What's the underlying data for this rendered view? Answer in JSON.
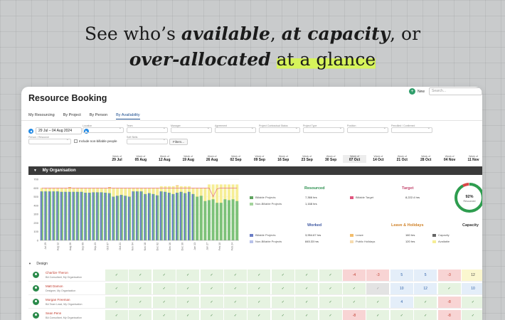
{
  "headline": {
    "line1_pre": "See who’s ",
    "line1_em1": "available",
    "line1_mid": ", ",
    "line1_em2": "at capacity",
    "line1_post": ", or",
    "line2_em": "over-allocated",
    "line2_highlight": "at a glance"
  },
  "app": {
    "title": "Resource Booking",
    "new_label": "New",
    "search_placeholder": "Search...",
    "tabs": [
      "My Resourcing",
      "By Project",
      "By Person",
      "By Availability"
    ],
    "active_tab": 3
  },
  "filters": {
    "date_range": "29 Jul – 04 Aug 2024",
    "labels": [
      "Location",
      "Team",
      "Manager",
      "Agreement",
      "Project Contractual Status",
      "Project Type",
      "Position",
      "Pencilled / Confirmed",
      "Person / Resource",
      "Soft Skills"
    ],
    "include_non_billable": "Include non-billable people",
    "filters_button": "Filters..."
  },
  "weeks": {
    "prefix": "Week of",
    "dates": [
      "29 Jul",
      "05 Aug",
      "12 Aug",
      "19 Aug",
      "26 Aug",
      "02 Sep",
      "09 Sep",
      "16 Sep",
      "23 Sep",
      "30 Sep",
      "07 Oct",
      "14 Oct",
      "21 Oct",
      "28 Oct",
      "04 Nov",
      "11 Nov"
    ],
    "current_index": 10
  },
  "org_label": "My Organisation",
  "chart_data": {
    "type": "bar",
    "categories": [
      "Jul 29",
      "Aug 12",
      "Aug 26",
      "Sep 09",
      "Sep 23",
      "Oct 07",
      "Oct 21",
      "Nov 04",
      "Nov 18",
      "Dec 02",
      "Dec 16",
      "Dec 30",
      "Jan 13",
      "Jan 27",
      "Feb 10",
      "Feb 24"
    ],
    "tick_labels": [
      "Jul 29",
      "Aug 12",
      "Aug 26",
      "Sep 09",
      "Sep 23",
      "Oct 07",
      "Oct 21",
      "Nov 04",
      "Nov 18",
      "Dec 02",
      "Dec 16",
      "Dec 30",
      "Jan 13",
      "Jan 27",
      "Feb 10",
      "Feb 24"
    ],
    "ylim": [
      0,
      700
    ],
    "yticks": [
      0,
      100,
      200,
      300,
      400,
      500,
      600,
      700
    ],
    "bars": {
      "billable": [
        560,
        560,
        560,
        560,
        560,
        555,
        555,
        555,
        555,
        555,
        555,
        545,
        545,
        550,
        550,
        550,
        545,
        540,
        500,
        510,
        520,
        510,
        500,
        560,
        560,
        560,
        530,
        540,
        530,
        515,
        560,
        555,
        545,
        530,
        545,
        555,
        540,
        555,
        530,
        500,
        510,
        450,
        460,
        470,
        430,
        430,
        470,
        460,
        470,
        450
      ],
      "worked": [
        560,
        560,
        560,
        560,
        560,
        555,
        555,
        555,
        555,
        555,
        555,
        545,
        545,
        550,
        550,
        550,
        545,
        540,
        500,
        510,
        520,
        510,
        500,
        560,
        560,
        560,
        530,
        540,
        530,
        515,
        560,
        555,
        545,
        530,
        545,
        555,
        540,
        555,
        530,
        0,
        0,
        0,
        0,
        0,
        0,
        0,
        0,
        0,
        0,
        0
      ],
      "capacity": [
        600,
        600,
        600,
        600,
        600,
        600,
        600,
        600,
        600,
        600,
        600,
        600,
        600,
        600,
        600,
        600,
        600,
        600,
        600,
        600,
        600,
        600,
        600,
        600,
        600,
        600,
        600,
        600,
        600,
        600,
        620,
        620,
        620,
        620,
        620,
        620,
        620,
        620,
        600,
        600,
        600,
        600,
        640,
        640,
        640,
        640,
        640,
        640,
        640,
        640
      ],
      "leave": [
        0,
        0,
        0,
        0,
        0,
        0,
        0,
        10,
        0,
        0,
        0,
        0,
        0,
        0,
        0,
        0,
        0,
        10,
        0,
        0,
        0,
        0,
        0,
        0,
        0,
        0,
        0,
        0,
        0,
        0,
        0,
        0,
        0,
        0,
        10,
        0,
        0,
        0,
        0,
        0,
        0,
        0,
        0,
        0,
        0,
        0,
        0,
        0,
        0,
        0
      ],
      "target_line": [
        600,
        600,
        600,
        600,
        600,
        600,
        600,
        600,
        600,
        600,
        600,
        600,
        600,
        600,
        600,
        600,
        600,
        600,
        600,
        600,
        600,
        600,
        600,
        600,
        600,
        600,
        600,
        600,
        600,
        600,
        600,
        600,
        600,
        600,
        600,
        600,
        600,
        600,
        600,
        600,
        600,
        600,
        600,
        500,
        590,
        600,
        600,
        600,
        600,
        600
      ]
    }
  },
  "summary": {
    "resourced": {
      "title": "Resourced",
      "rows": [
        {
          "label": "Billable Projects",
          "value": "7,366 hrs",
          "color": "#5fa35f"
        },
        {
          "label": "Non-Billable Projects",
          "value": "1,168 hrs",
          "color": "#a3d39c"
        }
      ]
    },
    "target": {
      "title": "Target",
      "rows": [
        {
          "label": "Billable Target",
          "value": "8,222.4 hrs",
          "color": "#e0567f"
        }
      ]
    },
    "worked": {
      "title": "Worked",
      "rows": [
        {
          "label": "Billable Projects",
          "value": "3,954.67 hrs",
          "color": "#6a7dc6"
        },
        {
          "label": "Non-Billable Projects",
          "value": "845.33 hrs",
          "color": "#b8c2ea"
        }
      ]
    },
    "leave": {
      "title": "Leave & Holidays",
      "rows": [
        {
          "label": "Leave",
          "value": "160 hrs",
          "color": "#f3bd6c"
        },
        {
          "label": "Public Holidays",
          "value": "120 hrs",
          "color": "#f6dcb0"
        }
      ]
    },
    "capacity": {
      "title": "Capacity",
      "rows": [
        {
          "label": "Capacity",
          "color": "#666666"
        },
        {
          "label": "Available",
          "color": "#f6ee96"
        }
      ]
    },
    "gauge": {
      "percent": 92,
      "percent_label": "92%",
      "caption": "Resourced",
      "color": "#2e9d4f",
      "over_color": "#d94848"
    }
  },
  "design_group": "Design",
  "people": [
    {
      "name": "Charlize Theron",
      "role": "BA Consultant, My Organisation",
      "cells": [
        [
          "ok",
          "✓"
        ],
        [
          "ok",
          "✓"
        ],
        [
          "ok",
          "✓"
        ],
        [
          "ok",
          "✓"
        ],
        [
          "ok",
          "✓"
        ],
        [
          "ok",
          "✓"
        ],
        [
          "ok",
          "✓"
        ],
        [
          "ok",
          "✓"
        ],
        [
          "ok",
          "✓"
        ],
        [
          "ok",
          "✓"
        ],
        [
          "over",
          "-4"
        ],
        [
          "over",
          "-3"
        ],
        [
          "avail",
          "5"
        ],
        [
          "avail",
          "5"
        ],
        [
          "over",
          "-3"
        ],
        [
          "cap",
          "12"
        ],
        [
          "cap",
          "12"
        ]
      ]
    },
    {
      "name": "Matt Damon",
      "role": "Designer, My Organisation",
      "cells": [
        [
          "ok",
          "✓"
        ],
        [
          "ok",
          "✓"
        ],
        [
          "ok",
          "✓"
        ],
        [
          "ok",
          "✓"
        ],
        [
          "ok",
          "✓"
        ],
        [
          "ok",
          "✓"
        ],
        [
          "ok",
          "✓"
        ],
        [
          "ok",
          "✓"
        ],
        [
          "ok",
          "✓"
        ],
        [
          "ok",
          "✓"
        ],
        [
          "ok",
          "✓"
        ],
        [
          "grey",
          "✓"
        ],
        [
          "avail",
          "10"
        ],
        [
          "avail",
          "12"
        ],
        [
          "ok",
          "✓"
        ],
        [
          "avail",
          "10"
        ],
        [
          "avail",
          "12"
        ]
      ]
    },
    {
      "name": "Morgan Freeman",
      "role": "BA Team Lead, My Organisation",
      "cells": [
        [
          "ok",
          "✓"
        ],
        [
          "ok",
          "✓"
        ],
        [
          "ok",
          "✓"
        ],
        [
          "ok",
          "✓"
        ],
        [
          "ok",
          "✓"
        ],
        [
          "ok",
          "✓"
        ],
        [
          "ok",
          "✓"
        ],
        [
          "ok",
          "✓"
        ],
        [
          "ok",
          "✓"
        ],
        [
          "ok",
          "✓"
        ],
        [
          "ok",
          "✓"
        ],
        [
          "ok",
          "✓"
        ],
        [
          "avail",
          "4"
        ],
        [
          "ok",
          "✓"
        ],
        [
          "over",
          "-8"
        ],
        [
          "ok",
          "✓"
        ],
        [
          "ok",
          "✓"
        ]
      ]
    },
    {
      "name": "Sean Penn",
      "role": "BA Consultant, My Organisation",
      "cells": [
        [
          "ok",
          "✓"
        ],
        [
          "ok",
          "✓"
        ],
        [
          "ok",
          "✓"
        ],
        [
          "ok",
          "✓"
        ],
        [
          "ok",
          "✓"
        ],
        [
          "ok",
          "✓"
        ],
        [
          "ok",
          "✓"
        ],
        [
          "ok",
          "✓"
        ],
        [
          "ok",
          "✓"
        ],
        [
          "ok",
          "✓"
        ],
        [
          "over",
          "-8"
        ],
        [
          "ok",
          "✓"
        ],
        [
          "ok",
          "✓"
        ],
        [
          "ok",
          "✓"
        ],
        [
          "over",
          "-8"
        ],
        [
          "ok",
          "✓"
        ],
        [
          "ok",
          "✓"
        ]
      ]
    }
  ]
}
